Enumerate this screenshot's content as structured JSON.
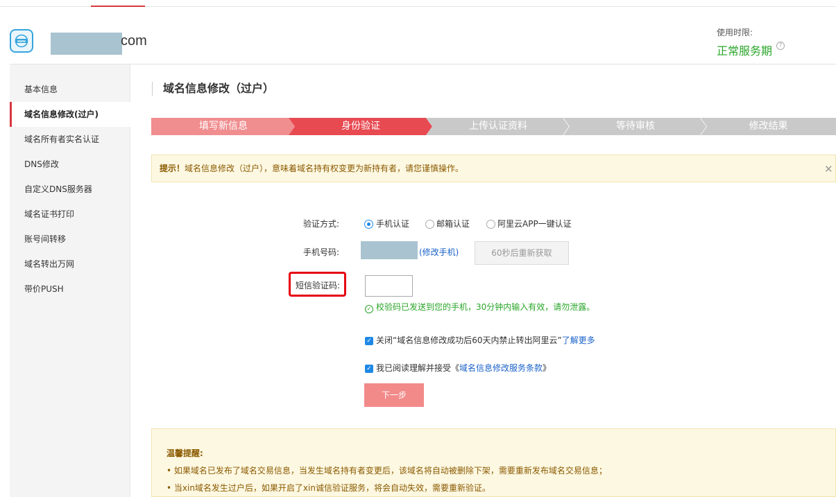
{
  "header": {
    "domain_suffix": "com",
    "service_label": "使用时限:",
    "service_status": "正常服务期",
    "help_glyph": "?"
  },
  "sidebar": {
    "items": [
      {
        "label": "基本信息"
      },
      {
        "label": "域名信息修改(过户)",
        "active": true
      },
      {
        "label": "域名所有者实名认证"
      },
      {
        "label": "DNS修改"
      },
      {
        "label": "自定义DNS服务器"
      },
      {
        "label": "域名证书打印"
      },
      {
        "label": "账号间转移"
      },
      {
        "label": "域名转出万网"
      },
      {
        "label": "带价PUSH"
      }
    ]
  },
  "main": {
    "title": "域名信息修改（过户）",
    "steps": [
      {
        "label": "填写新信息",
        "state": "done",
        "color": "#f08d8f"
      },
      {
        "label": "身份验证",
        "state": "current",
        "color": "#e84a52"
      },
      {
        "label": "上传认证资料",
        "state": "pending",
        "color": "#c9c9c9"
      },
      {
        "label": "等待审核",
        "state": "pending",
        "color": "#c9c9c9"
      },
      {
        "label": "修改结果",
        "state": "pending",
        "color": "#c9c9c9"
      }
    ],
    "notice": {
      "prefix": "提示！",
      "text": "域名信息修改（过户），意味着域名持有权变更为新持有者，请您谨慎操作。",
      "close_glyph": "✕"
    },
    "form": {
      "verify_method_label": "验证方式:",
      "methods": [
        {
          "label": "手机认证",
          "checked": true
        },
        {
          "label": "邮箱认证",
          "checked": false
        },
        {
          "label": "阿里云APP一键认证",
          "checked": false
        }
      ],
      "phone_label": "手机号码:",
      "change_phone_link": "(修改手机)",
      "resend_button": "60秒后重新获取",
      "sms_label": "短信验证码:",
      "sms_value": "",
      "sent_message": "校验码已发送到您的手机，30分钟内输入有效，请勿泄露。",
      "close_transfer_text": "关闭“域名信息修改成功后60天内禁止转出阿里云”",
      "learn_more_link": "了解更多",
      "agree_text": "我已阅读理解并接受《",
      "agree_link": "域名信息修改服务条款",
      "agree_suffix": "》",
      "next_button": "下一步"
    },
    "tips": {
      "title": "温馨提醒:",
      "lines": [
        "• 如果域名已发布了域名交易信息，当发生域名持有者变更后，该域名将自动被删除下架，需要重新发布域名交易信息；",
        "• 当xin域名发生过户后，如果开启了xin诚信验证服务，将会自动失效，需要重新验证。"
      ]
    }
  }
}
